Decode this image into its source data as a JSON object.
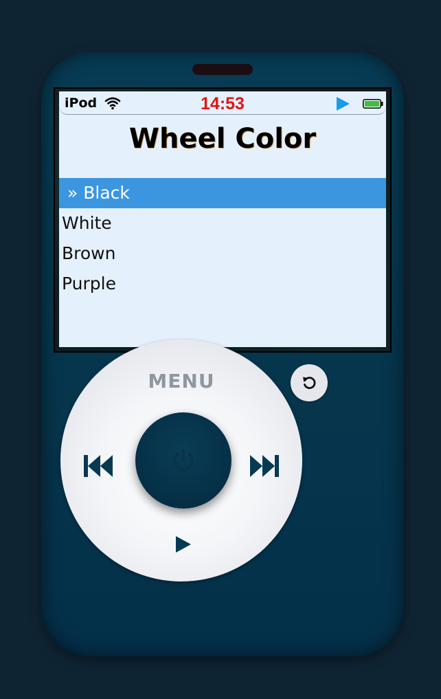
{
  "status_bar": {
    "brand": "iPod",
    "time": "14:53",
    "wifi_icon": "wifi-icon",
    "play_icon": "play-status-icon",
    "battery_icon": "battery-icon",
    "time_color": "#e31414",
    "play_color": "#1a9be6",
    "battery_color": "#3fbf3a"
  },
  "screen": {
    "title": "Wheel Color",
    "items": [
      {
        "label": "» Black",
        "selected": true
      },
      {
        "label": "White",
        "selected": false
      },
      {
        "label": "Brown",
        "selected": false
      },
      {
        "label": "Purple",
        "selected": false
      }
    ],
    "selection_color": "#3c96df",
    "background": "#e4f1fc"
  },
  "wheel": {
    "menu_label": "MENU",
    "prev_icon": "skip-previous-icon",
    "next_icon": "skip-next-icon",
    "play_icon": "play-icon",
    "center_icon": "power-icon",
    "body_color": "#073b54"
  },
  "refresh_button": {
    "icon": "refresh-icon"
  }
}
